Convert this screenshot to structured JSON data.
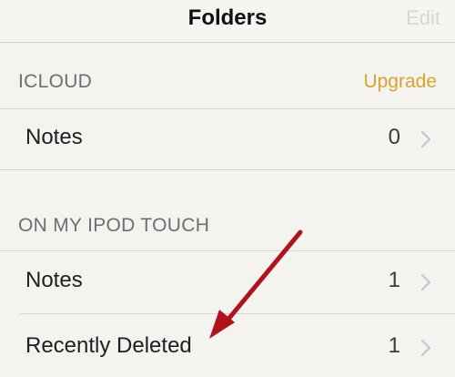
{
  "navbar": {
    "title": "Folders",
    "edit_label": "Edit"
  },
  "sections": [
    {
      "header": "ICLOUD",
      "action_label": "Upgrade",
      "rows": [
        {
          "label": "Notes",
          "count": "0"
        }
      ]
    },
    {
      "header": "ON MY IPOD TOUCH",
      "rows": [
        {
          "label": "Notes",
          "count": "1"
        },
        {
          "label": "Recently Deleted",
          "count": "1"
        }
      ]
    }
  ],
  "colors": {
    "background": "#f4f3ef",
    "accent": "#d8a52a",
    "annotation_arrow": "#b0121b"
  },
  "icons": {
    "row_disclosure": "chevron-right-icon",
    "annotation": "arrow-annotation-icon"
  }
}
